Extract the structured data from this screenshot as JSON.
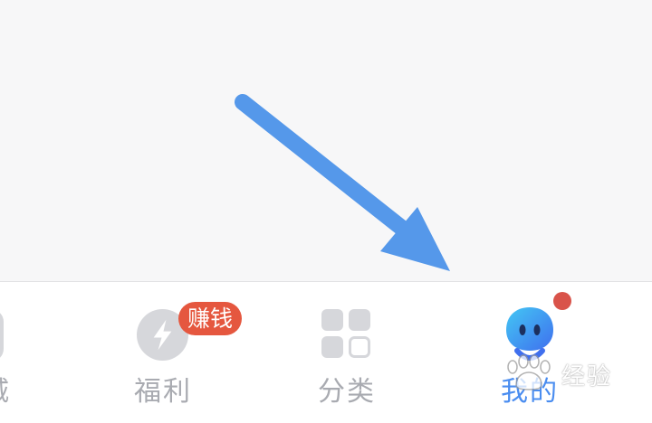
{
  "tab_bar": {
    "tabs": [
      {
        "id": "partial",
        "label": "城",
        "active": false
      },
      {
        "id": "welfare",
        "label": "福利",
        "active": false,
        "badge": "赚钱"
      },
      {
        "id": "category",
        "label": "分类",
        "active": false
      },
      {
        "id": "mine",
        "label": "我的",
        "active": true,
        "has_dot_badge": true
      }
    ]
  },
  "watermark": {
    "text": "经验"
  },
  "colors": {
    "background": "#f7f7f8",
    "tab_bar_background": "#ffffff",
    "inactive_label": "#a9abb1",
    "active_label": "#4a8df0",
    "badge_red": "#e5573f",
    "dot_red": "#d9534a",
    "icon_gray": "#d6d7db",
    "arrow_blue": "#5598ea"
  },
  "icons": {
    "welfare": "lightning-circle-icon",
    "category": "grid-four-icon",
    "mine": "face-avatar-icon",
    "annotation": "arrow-pointing-icon"
  }
}
